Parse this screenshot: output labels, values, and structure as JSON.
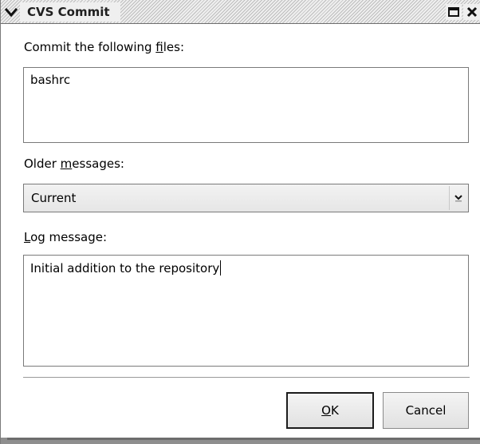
{
  "window": {
    "title": "CVS Commit"
  },
  "files_section": {
    "label_prefix": "Commit the following ",
    "label_mnemonic": "f",
    "label_suffix": "iles:",
    "content": "bashrc"
  },
  "older_messages": {
    "label_prefix": "Older ",
    "label_mnemonic": "m",
    "label_suffix": "essages:",
    "selected": "Current"
  },
  "log_message": {
    "label_mnemonic": "L",
    "label_suffix": "og message:",
    "value": "Initial addition to the repository"
  },
  "buttons": {
    "ok_mnemonic": "O",
    "ok_suffix": "K",
    "cancel": "Cancel"
  },
  "colors": {
    "frame": "#7a7a7a",
    "button_default_border": "#1c1c1c",
    "titlebar_stripe": "#bdbdbd"
  }
}
